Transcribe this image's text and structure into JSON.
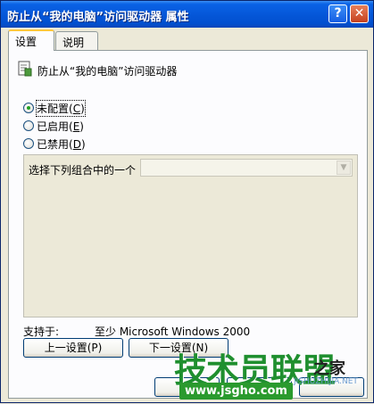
{
  "window": {
    "title": "防止从“我的电脑”访问驱动器 属性",
    "help_button": "?",
    "close_button": "✕"
  },
  "tabs": [
    {
      "label": "设置",
      "active": true
    },
    {
      "label": "说明",
      "active": false
    }
  ],
  "policy": {
    "title": "防止从“我的电脑”访问驱动器",
    "icon": "policy-settings-icon"
  },
  "radios": [
    {
      "label": "未配置",
      "hotkey": "C",
      "checked": true
    },
    {
      "label": "已启用",
      "hotkey": "E",
      "checked": false
    },
    {
      "label": "已禁用",
      "hotkey": "D",
      "checked": false
    }
  ],
  "options": {
    "label": "选择下列组合中的一个",
    "combo_value": ""
  },
  "supported": {
    "label": "支持于:",
    "value": "至少 Microsoft Windows 2000"
  },
  "nav_buttons": {
    "prev": "上一设置(P)",
    "next": "下一设置(N)"
  },
  "watermark": {
    "brand": "技术员联盟",
    "sub": "之家",
    "url": "www.jsgho.com",
    "host": "JISHUZHIJIA.NET"
  },
  "colors": {
    "titlebar": "#0455d6",
    "dialog_bg": "#ece9d8",
    "watermark_green": "#1f8f2f"
  }
}
